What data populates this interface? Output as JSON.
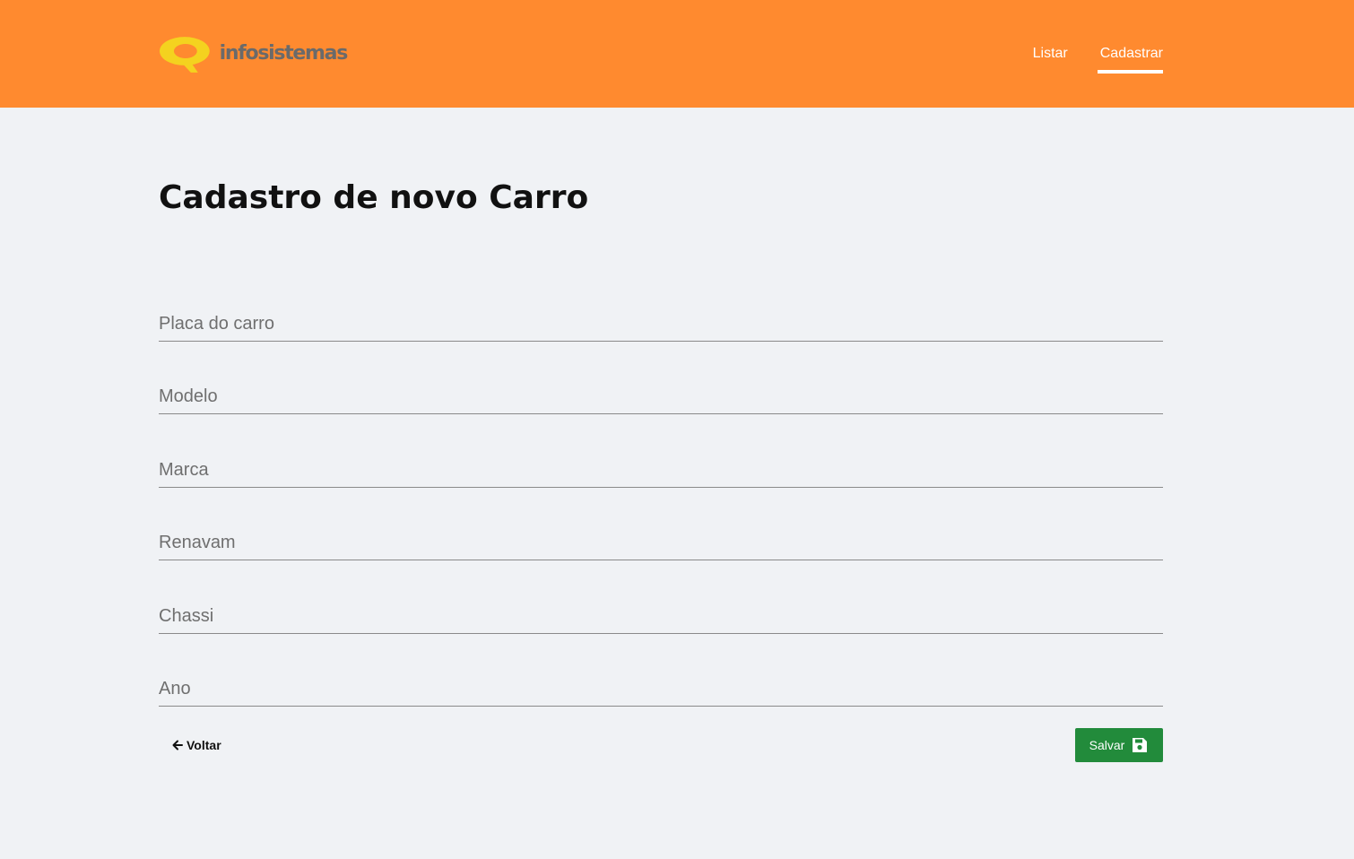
{
  "header": {
    "logo_text": "infosistemas",
    "nav": [
      {
        "label": "Listar",
        "active": false
      },
      {
        "label": "Cadastrar",
        "active": true
      }
    ],
    "background_color": "#ff8a2f"
  },
  "page": {
    "title": "Cadastro de novo Carro"
  },
  "form": {
    "fields": [
      {
        "placeholder": "Placa do carro",
        "value": ""
      },
      {
        "placeholder": "Modelo",
        "value": ""
      },
      {
        "placeholder": "Marca",
        "value": ""
      },
      {
        "placeholder": "Renavam",
        "value": ""
      },
      {
        "placeholder": "Chassi",
        "value": ""
      },
      {
        "placeholder": "Ano",
        "value": ""
      }
    ]
  },
  "actions": {
    "back_label": "Voltar",
    "back_icon": "arrow-left-icon",
    "save_label": "Salvar",
    "save_icon": "floppy-disk-icon",
    "save_color": "#228b3b"
  }
}
